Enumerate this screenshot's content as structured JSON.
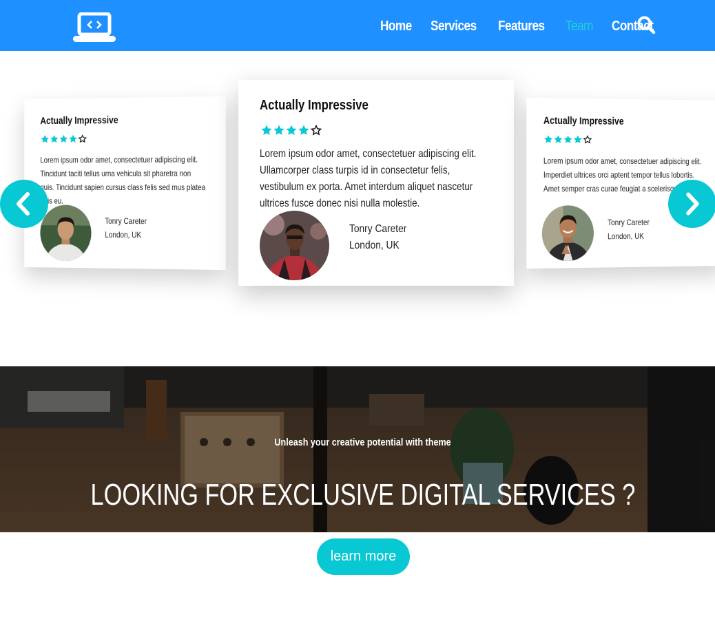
{
  "navbar": {
    "logo_icon": "laptop-code-icon",
    "links": [
      {
        "label": "Home",
        "active": false
      },
      {
        "label": "Services",
        "active": false
      },
      {
        "label": "Features",
        "active": false
      },
      {
        "label": "Team",
        "active": true
      },
      {
        "label": "Contact",
        "active": false
      }
    ],
    "search_icon": "search-icon",
    "colors": {
      "background": "#1e90ff",
      "active_link": "#1fd1d8",
      "link": "#ffffff"
    }
  },
  "testimonials": {
    "cards": [
      {
        "title": "Actually Impressive",
        "rating": 4,
        "max_rating": 5,
        "text": "Lorem ipsum odor amet, consectetuer adipiscing elit. Tincidunt taciti tellus urna vehicula sit pharetra non quis. Tincidunt sapien cursus class felis sed mus platea quis eu.",
        "name": "Tonry Careter",
        "location": "London, UK"
      },
      {
        "title": "Actually Impressive",
        "rating": 4,
        "max_rating": 5,
        "text": "Lorem ipsum odor amet, consectetuer adipiscing elit. Ullamcorper class turpis id in consectetur felis, vestibulum ex porta. Amet interdum aliquet nascetur ultrices fusce donec nisi nulla molestie.",
        "name": "Tonry Careter",
        "location": "London, UK"
      },
      {
        "title": "Actually Impressive",
        "rating": 4,
        "max_rating": 5,
        "text": "Lorem ipsum odor amet, consectetuer adipiscing elit. Imperdiet ultrices orci aptent tempor tellus lobortis. Amet semper cras curae feugiat a scelerisque",
        "name": "Tonry Careter",
        "location": "London, UK"
      }
    ],
    "prev_icon": "chevron-left-icon",
    "next_icon": "chevron-right-icon",
    "accent_color": "#08c8d3"
  },
  "banner": {
    "subtitle": "Unleash your creative potential with theme",
    "title": "LOOKING FOR EXCLUSIVE DIGITAL SERVICES ?",
    "cta_label": "learn more"
  }
}
